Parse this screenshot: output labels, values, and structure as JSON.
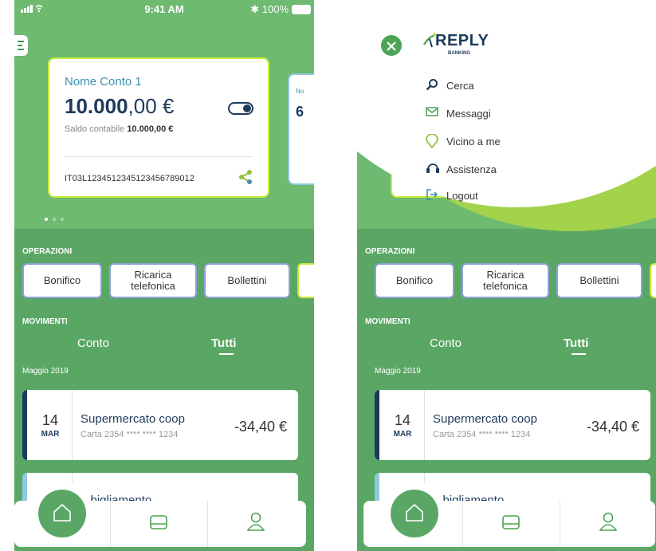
{
  "status_bar": {
    "time": "9:41 AM",
    "battery": "100%"
  },
  "account_card": {
    "name": "Nome Conto 1",
    "amount_int": "10.000",
    "amount_dec": ",00 €",
    "saldo_label": "Saldo contabile",
    "saldo_value": "10.000,00 €",
    "iban": "IT03L1234512345123456789012"
  },
  "second_card": {
    "name": "No",
    "amount": "6"
  },
  "sections": {
    "operations": "OPERAZIONI",
    "movements": "MOVIMENTI"
  },
  "operations": [
    {
      "label": "Bonifico"
    },
    {
      "label": "Ricarica telefonica"
    },
    {
      "label": "Bollettini"
    }
  ],
  "movement_tabs": [
    {
      "label": "Conto",
      "active": false
    },
    {
      "label": "Tutti",
      "active": true
    }
  ],
  "month_label": "Maggio 2019",
  "movements": [
    {
      "day": "14",
      "month": "MAR",
      "title": "Supermercato coop",
      "subtitle": "Carta 2354 **** **** 1234",
      "amount": "-34,40 €"
    },
    {
      "title": "...bigliamento"
    }
  ],
  "side_menu": {
    "brand": "REPLY",
    "brand_sub": "BANKING",
    "items": [
      {
        "label": "Cerca",
        "icon": "search-icon"
      },
      {
        "label": "Messaggi",
        "icon": "envelope-icon"
      },
      {
        "label": "Vicino a me",
        "icon": "location-pin-icon"
      },
      {
        "label": "Assistenza",
        "icon": "headset-icon"
      },
      {
        "label": "Logout",
        "icon": "logout-icon"
      }
    ]
  },
  "bottom_nav": [
    {
      "icon": "home-icon"
    },
    {
      "icon": "card-icon"
    },
    {
      "icon": "user-icon"
    }
  ],
  "colors": {
    "brand_green": "#5aa765",
    "lime": "#c8ea3a",
    "navy": "#1d3a5c"
  }
}
